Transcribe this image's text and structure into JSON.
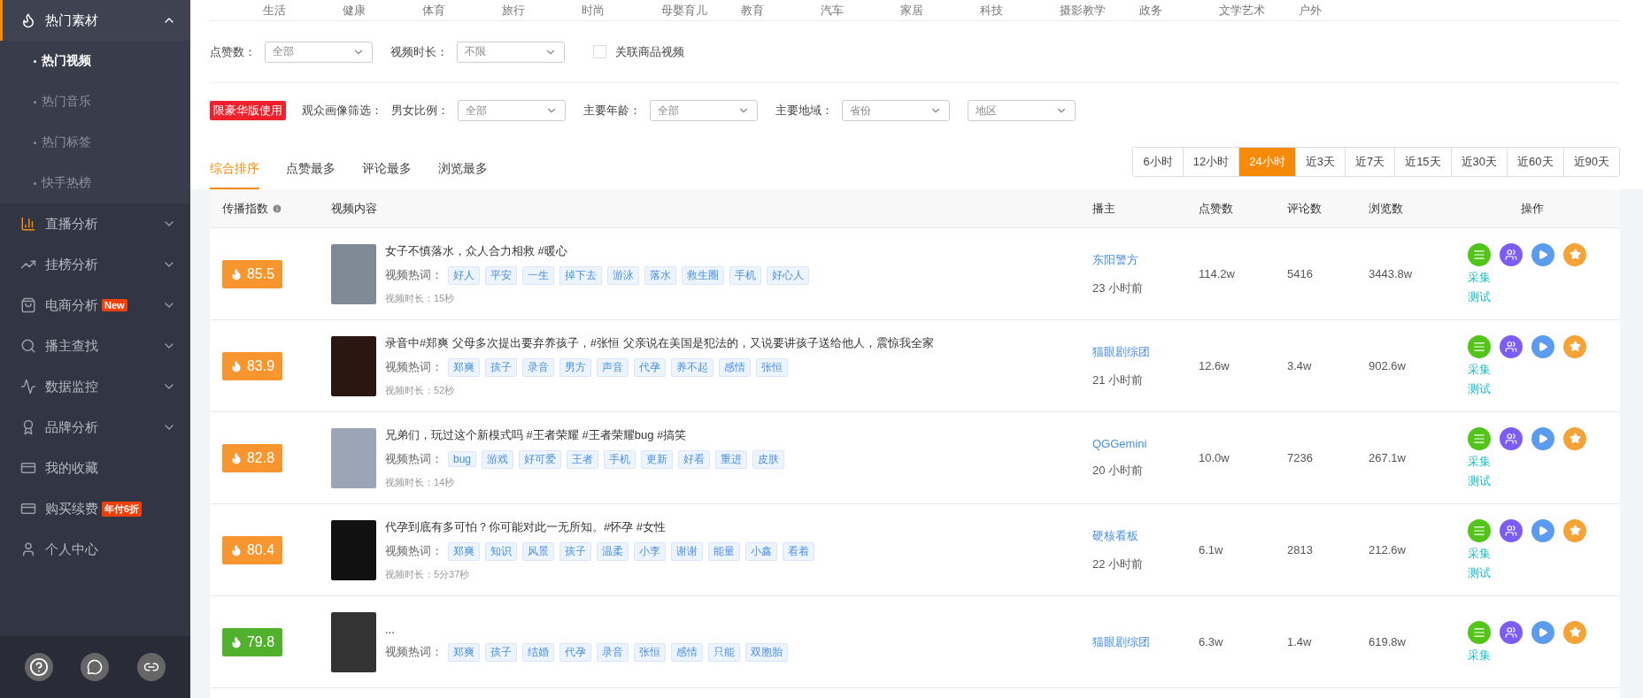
{
  "sidebar": {
    "items": [
      {
        "kind": "group",
        "label": "热门素材",
        "expanded": true,
        "children": [
          {
            "label": "热门视频",
            "selected": true
          },
          {
            "label": "热门音乐",
            "selected": false
          },
          {
            "label": "热门标签",
            "selected": false
          },
          {
            "label": "快手热榜",
            "selected": false
          }
        ]
      },
      {
        "kind": "group",
        "label": "直播分析",
        "expanded": false
      },
      {
        "kind": "group",
        "label": "挂榜分析",
        "expanded": false
      },
      {
        "kind": "group",
        "label": "电商分析",
        "badge": "New",
        "expanded": false
      },
      {
        "kind": "group",
        "label": "播主查找",
        "expanded": false
      },
      {
        "kind": "group",
        "label": "数据监控",
        "expanded": false
      },
      {
        "kind": "group",
        "label": "品牌分析",
        "expanded": false
      },
      {
        "kind": "link",
        "label": "我的收藏"
      },
      {
        "kind": "link",
        "label": "购买续费",
        "badge": "年付6折"
      },
      {
        "kind": "link",
        "label": "个人中心"
      }
    ]
  },
  "categories": [
    "生活",
    "健康",
    "体育",
    "旅行",
    "时尚",
    "母婴育儿",
    "教育",
    "汽车",
    "家居",
    "科技",
    "摄影教学",
    "政务",
    "文学艺术",
    "户外"
  ],
  "filters": {
    "selects": [
      {
        "label": "点赞数：",
        "value": "全部"
      },
      {
        "label": "视频时长：",
        "value": "不限"
      }
    ],
    "checkbox": {
      "label": "关联商品视频",
      "checked": false
    }
  },
  "audience": {
    "badge": "限豪华版使用",
    "title": "观众画像筛选：",
    "selects": [
      {
        "label": "男女比例：",
        "value": "全部"
      },
      {
        "label": "主要年龄：",
        "value": "全部"
      },
      {
        "label": "主要地域：",
        "value": "省份"
      },
      {
        "value": "地区"
      }
    ]
  },
  "sort_tabs": [
    {
      "label": "综合排序",
      "selected": true
    },
    {
      "label": "点赞最多",
      "selected": false
    },
    {
      "label": "评论最多",
      "selected": false
    },
    {
      "label": "浏览最多",
      "selected": false
    }
  ],
  "time_ranges": [
    {
      "label": "6小时",
      "selected": false
    },
    {
      "label": "12小时",
      "selected": false
    },
    {
      "label": "24小时",
      "selected": true
    },
    {
      "label": "近3天",
      "selected": false
    },
    {
      "label": "近7天",
      "selected": false
    },
    {
      "label": "近15天",
      "selected": false
    },
    {
      "label": "近30天",
      "selected": false
    },
    {
      "label": "近60天",
      "selected": false
    },
    {
      "label": "近90天",
      "selected": false
    }
  ],
  "table": {
    "columns": [
      "传播指数",
      "视频内容",
      "播主",
      "点赞数",
      "评论数",
      "浏览数",
      "操作"
    ],
    "rows": [
      {
        "score": "85.5",
        "color": "#f7962e",
        "title": "女子不慎落水，众人合力相救 #暖心",
        "tags_label": "视频热词：",
        "tags": [
          "好人",
          "平安",
          "一生",
          "掉下去",
          "游泳",
          "落水",
          "救生圈",
          "手机",
          "好心人"
        ],
        "duration": "视频时长：15秒",
        "author": "东阳警方",
        "time": "23 小时前",
        "likes": "114.2w",
        "comments": "5416",
        "views": "3443.8w",
        "actions": [
          "采集",
          "测试"
        ]
      },
      {
        "score": "83.9",
        "color": "#f7962e",
        "title": "录音中#郑爽 父母多次提出要弃养孩子，#张恒 父亲说在美国是犯法的，又说要讲孩子送给他人，震惊我全家",
        "tags_label": "视频热词：",
        "tags": [
          "郑爽",
          "孩子",
          "录音",
          "男方",
          "声音",
          "代孕",
          "养不起",
          "感情",
          "张恒"
        ],
        "duration": "视频时长：52秒",
        "author": "猫眼剧综团",
        "time": "21 小时前",
        "likes": "12.6w",
        "comments": "3.4w",
        "views": "902.6w",
        "actions": [
          "采集",
          "测试"
        ]
      },
      {
        "score": "82.8",
        "color": "#f7962e",
        "title": "兄弟们，玩过这个新模式吗 #王者荣耀 #王者荣耀bug #搞笑",
        "tags_label": "视频热词：",
        "tags": [
          "bug",
          "游戏",
          "好可爱",
          "王者",
          "手机",
          "更新",
          "好看",
          "重进",
          "皮肤"
        ],
        "duration": "视频时长：14秒",
        "author": "QGGemini",
        "time": "20 小时前",
        "likes": "10.0w",
        "comments": "7236",
        "views": "267.1w",
        "actions": [
          "采集",
          "测试"
        ]
      },
      {
        "score": "80.4",
        "color": "#f7962e",
        "title": "代孕到底有多可怕？你可能对此一无所知。#怀孕 #女性",
        "tags_label": "视频热词：",
        "tags": [
          "郑爽",
          "知识",
          "风景",
          "孩子",
          "温柔",
          "小李",
          "谢谢",
          "能量",
          "小鑫",
          "看着"
        ],
        "duration": "视频时长：5分37秒",
        "author": "硬核看板",
        "time": "22 小时前",
        "likes": "6.1w",
        "comments": "2813",
        "views": "212.6w",
        "actions": [
          "采集",
          "测试"
        ]
      },
      {
        "score": "79.8",
        "color": "#52b12c",
        "title": "...",
        "tags_label": "视频热词：",
        "tags": [
          "郑爽",
          "孩子",
          "结婚",
          "代孕",
          "录音",
          "张恒",
          "感情",
          "只能",
          "双胞胎"
        ],
        "author": "猫眼剧综团",
        "likes": "6.3w",
        "comments": "1.4w",
        "views": "619.8w",
        "actions": [
          "采集"
        ]
      }
    ]
  }
}
